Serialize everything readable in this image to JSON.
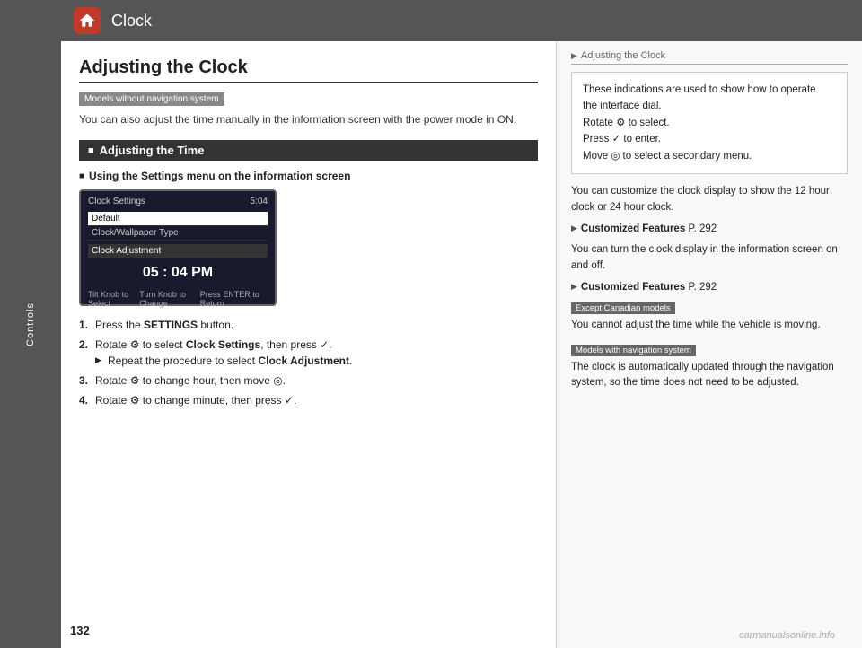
{
  "sidebar": {
    "label": "Controls"
  },
  "header": {
    "title": "Clock",
    "icon": "home"
  },
  "page_number": "132",
  "left": {
    "section_title": "Adjusting the Clock",
    "badge1": "Models without navigation system",
    "intro_text": "You can also adjust the time manually in the information screen with the power mode in ON.",
    "subsection": "Adjusting the Time",
    "sub_sub_title": "Using the Settings menu on the information screen",
    "screen": {
      "title": "Clock Settings",
      "time": "5:04",
      "item1": "Default",
      "item2": "Clock/Wallpaper Type",
      "adjustment_header": "Clock Adjustment",
      "time_display": "05 : 04  PM",
      "footer_left": "Tilt Knob to Select",
      "footer_mid": "Turn Knob to Change",
      "footer_right": "Press ENTER to Return"
    },
    "steps": [
      {
        "num": "1.",
        "text": "Press the ",
        "bold": "SETTINGS",
        "text2": " button."
      },
      {
        "num": "2.",
        "text": "Rotate ",
        "icon": "⚙",
        "text2": " to select ",
        "bold": "Clock Settings",
        "text3": ", then press ",
        "icon2": "✓",
        "text4": ".",
        "sub": "Repeat the procedure to select Clock Adjustment."
      },
      {
        "num": "3.",
        "text": "Rotate ",
        "icon": "⚙",
        "text2": " to change hour, then move ",
        "icon2": "◎",
        "text3": "."
      },
      {
        "num": "4.",
        "text": "Rotate ",
        "icon": "⚙",
        "text2": " to change minute, then press ",
        "icon2": "✓",
        "text3": "."
      }
    ]
  },
  "right": {
    "panel_title": "Adjusting the Clock",
    "box_lines": [
      "These indications are used to show how to operate",
      "the interface dial.",
      "Rotate ⚙ to select.",
      "Press ✓ to enter.",
      "Move ◎ to select a secondary menu."
    ],
    "text1": "You can customize the clock display to show the 12 hour clock or 24 hour clock.",
    "feature1_bold": "Customized Features",
    "feature1_page": "P. 292",
    "text2": "You can turn the clock display in the information screen on and off.",
    "feature2_bold": "Customized Features",
    "feature2_page": "P. 292",
    "badge2": "Except Canadian models",
    "note2": "You cannot adjust the time while the vehicle is moving.",
    "badge3": "Models with navigation system",
    "note3": "The clock is automatically updated through the navigation system, so the time does not need to be adjusted."
  },
  "watermark": "carmanualsonline.info"
}
